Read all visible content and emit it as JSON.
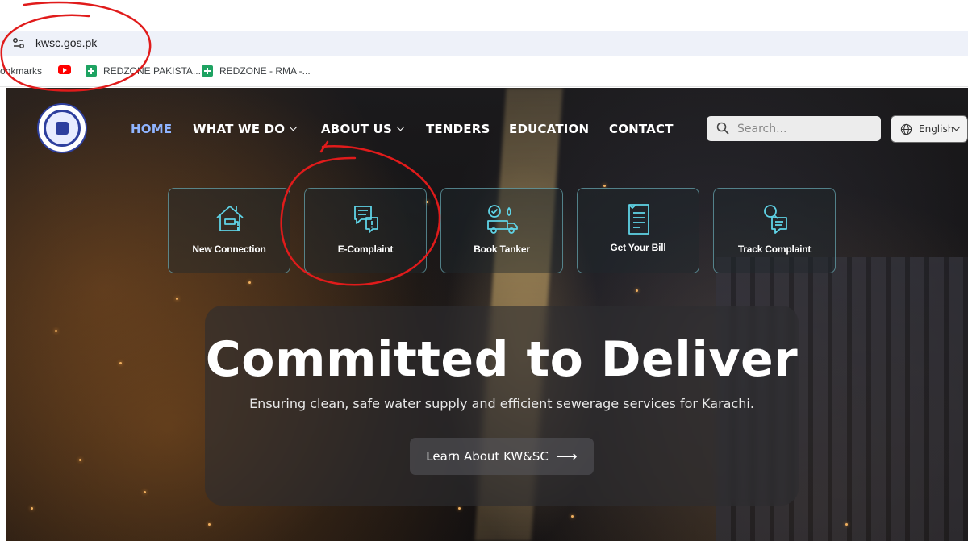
{
  "browser": {
    "url": "kwsc.gos.pk",
    "bookmarks": [
      {
        "label": "ookmarks",
        "icon": "none"
      },
      {
        "label": "",
        "icon": "youtube-icon"
      },
      {
        "label": "REDZONE PAKISTA...",
        "icon": "sheets-icon"
      },
      {
        "label": "REDZONE - RMA -...",
        "icon": "sheets-icon"
      }
    ]
  },
  "header": {
    "logo_alt": "KARACHI WATER AND SEWERAGE CORPORATION",
    "nav": [
      {
        "label": "HOME",
        "active": true,
        "dropdown": false
      },
      {
        "label": "WHAT WE DO",
        "active": false,
        "dropdown": true
      },
      {
        "label": "ABOUT US",
        "active": false,
        "dropdown": true
      },
      {
        "label": "TENDERS",
        "active": false,
        "dropdown": false
      },
      {
        "label": "EDUCATION",
        "active": false,
        "dropdown": false
      },
      {
        "label": "CONTACT",
        "active": false,
        "dropdown": false
      }
    ],
    "search_placeholder": "Search...",
    "language": "English"
  },
  "services": [
    {
      "label": "New Connection",
      "icon": "house-tap-icon"
    },
    {
      "label": "E-Complaint",
      "icon": "complaint-chat-icon"
    },
    {
      "label": "Book Tanker",
      "icon": "tanker-truck-icon"
    },
    {
      "label": "Get Your Bill",
      "icon": "bill-document-icon"
    },
    {
      "label": "Track Complaint",
      "icon": "track-search-icon"
    }
  ],
  "hero": {
    "title": "Committed to Deliver",
    "subtitle": "Ensuring clean, safe water supply and efficient sewerage services for Karachi.",
    "cta": "Learn About KW&SC"
  },
  "colors": {
    "accent_icon": "#5fd3e6",
    "nav_active": "#8fb4ff",
    "annotation": "#e01b1b"
  }
}
